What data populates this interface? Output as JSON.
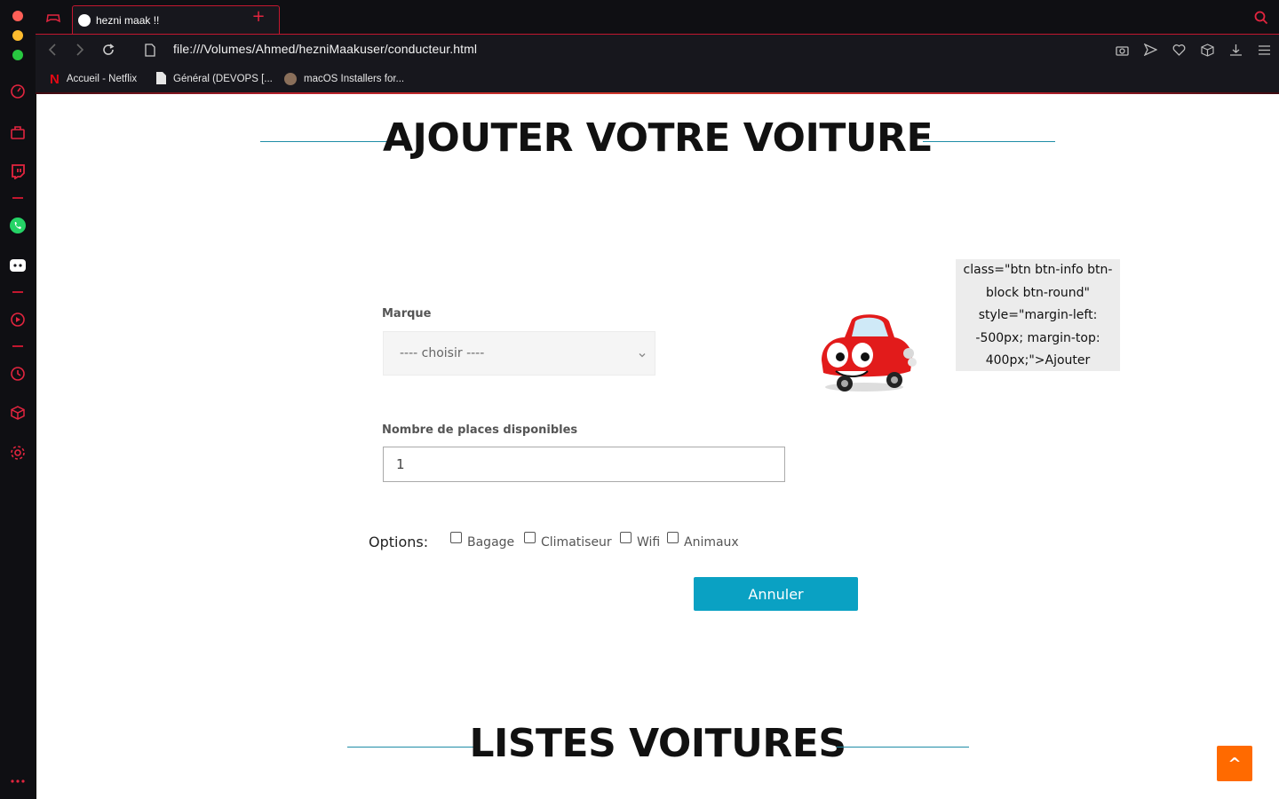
{
  "browser": {
    "tab_title": "hezni maak !!",
    "url": "file:///Volumes/Ahmed/hezniMaakuser/conducteur.html",
    "accent_color": "#c2172f",
    "bookmarks": [
      {
        "label": "Accueil - Netflix",
        "icon": "netflix-icon"
      },
      {
        "label": "Général (DEVOPS [...",
        "icon": "document-icon"
      },
      {
        "label": "macOS Installers for...",
        "icon": "avatar-icon"
      }
    ]
  },
  "sidebar": {
    "icons": [
      "speed-dial-icon",
      "extensions-icon",
      "twitch-icon",
      "whatsapp-icon",
      "discord-icon",
      "player-icon",
      "history-icon",
      "cube-icon",
      "settings-icon",
      "more-icon"
    ]
  },
  "form": {
    "heading": "AJOUTER VOTRE VOITURE",
    "marque_label": "Marque",
    "marque_value": "---- choisir ----",
    "places_label": "Nombre de places disponibles",
    "places_value": "1",
    "options_label": "Options:",
    "options": [
      "Bagage",
      "Climatiseur",
      "Wifi",
      "Animaux"
    ],
    "code_text_lines": [
      "class=\"btn btn-info btn-",
      "block btn-round\"",
      "style=\"margin-left:",
      "-500px; margin-top:",
      "400px;\">Ajouter"
    ],
    "cancel_label": "Annuler",
    "button_color": "#0aa1c3"
  },
  "list": {
    "heading": "LISTES VOITURES"
  },
  "scroll_top_label": "^",
  "scroll_top_color": "#ff6a00"
}
